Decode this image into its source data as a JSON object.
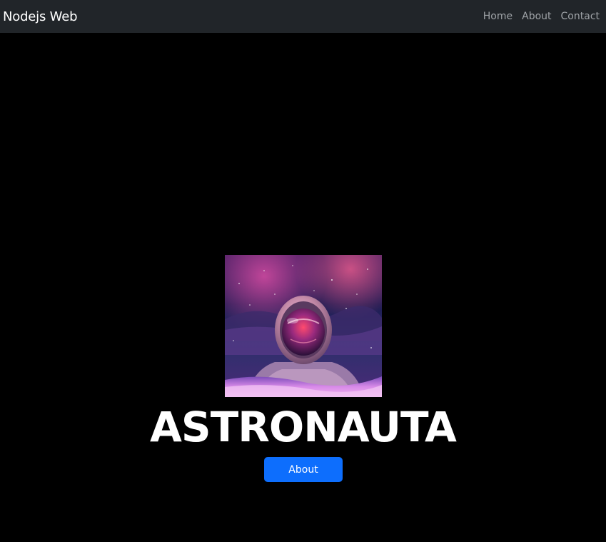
{
  "navbar": {
    "brand": "Nodejs Web",
    "links": [
      "Home",
      "About",
      "Contact"
    ]
  },
  "hero": {
    "title": "ASTRONAUTA",
    "button_label": "About",
    "image_name": "astronaut-image"
  },
  "colors": {
    "navbar_bg": "#212529",
    "page_bg": "#000000",
    "primary": "#0d6efd",
    "nav_link": "#9fa3a7"
  }
}
